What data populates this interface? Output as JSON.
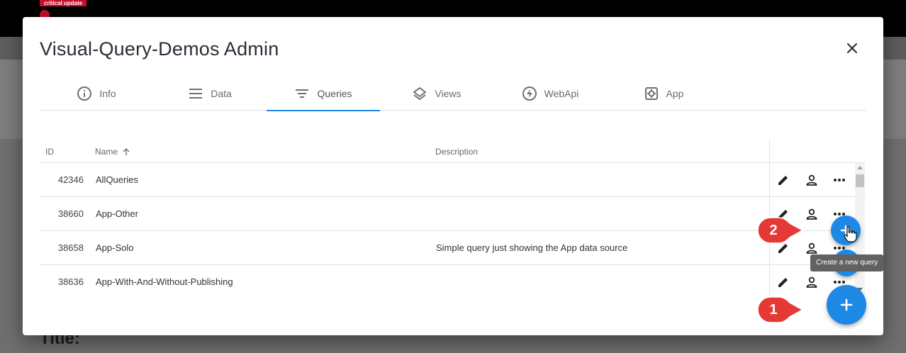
{
  "background": {
    "badge": "critical update",
    "page_heading": "Title:"
  },
  "dialog": {
    "title": "Visual-Query-Demos Admin",
    "close_icon": "close-icon"
  },
  "tabs": [
    {
      "label": "Info",
      "icon": "info-icon",
      "active": false
    },
    {
      "label": "Data",
      "icon": "menu-icon",
      "active": false
    },
    {
      "label": "Queries",
      "icon": "filter-icon",
      "active": true
    },
    {
      "label": "Views",
      "icon": "layers-icon",
      "active": false
    },
    {
      "label": "WebApi",
      "icon": "bolt-icon",
      "active": false
    },
    {
      "label": "App",
      "icon": "settings-icon",
      "active": false
    }
  ],
  "table": {
    "columns": {
      "id": "ID",
      "name": "Name",
      "description": "Description"
    },
    "rows": [
      {
        "id": "42346",
        "name": "AllQueries",
        "description": ""
      },
      {
        "id": "38660",
        "name": "App-Other",
        "description": ""
      },
      {
        "id": "38658",
        "name": "App-Solo",
        "description": "Simple query just showing the App data source"
      },
      {
        "id": "38636",
        "name": "App-With-And-Without-Publishing",
        "description": ""
      }
    ]
  },
  "fab": {
    "tooltip": "Create a new query"
  },
  "callouts": [
    "1",
    "2"
  ],
  "colors": {
    "accent": "#1e88e5",
    "callout": "#e53935"
  }
}
